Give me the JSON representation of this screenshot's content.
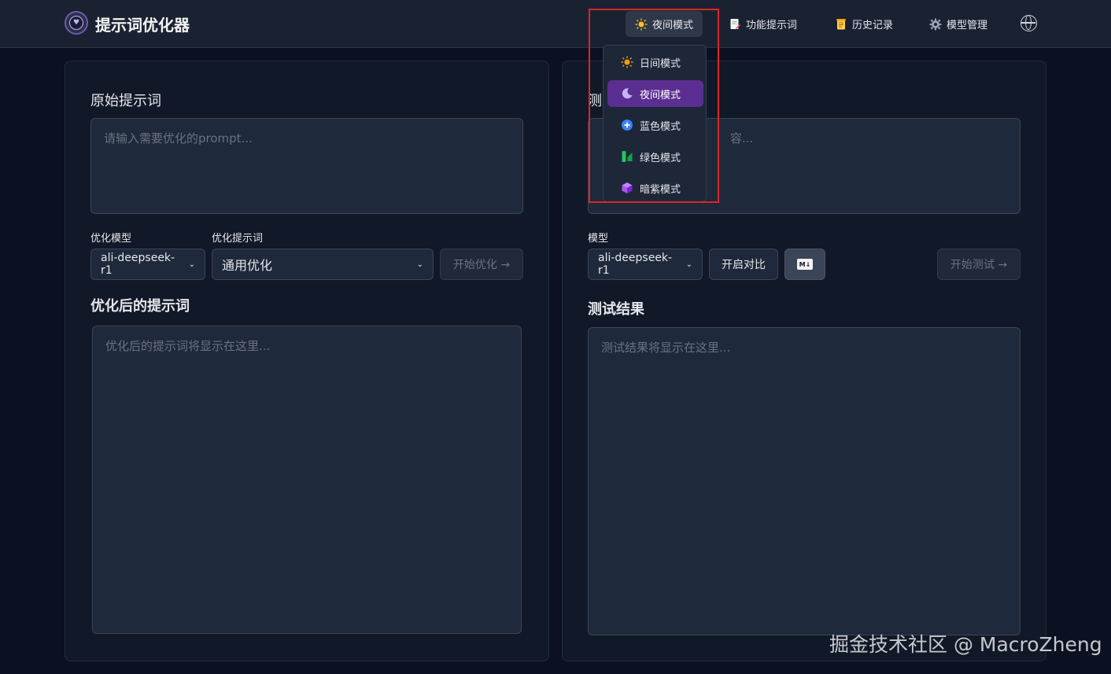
{
  "header": {
    "app_title": "提示词优化器",
    "nav": {
      "theme_label": "夜间模式",
      "features_label": "功能提示词",
      "history_label": "历史记录",
      "models_label": "模型管理"
    },
    "icons": {
      "logo": "heart-shield-icon",
      "theme": "sun-icon",
      "features": "document-icon",
      "history": "scroll-icon",
      "models": "gear-icon",
      "language": "globe-icon"
    }
  },
  "theme_menu": {
    "items": [
      {
        "label": "日间模式",
        "icon": "sun-icon",
        "color": "#f59e0b"
      },
      {
        "label": "夜间模式",
        "icon": "moon-icon",
        "color": "#c4b5fd",
        "selected": true
      },
      {
        "label": "蓝色模式",
        "icon": "blue-circle-plus-icon",
        "color": "#3b82f6"
      },
      {
        "label": "绿色模式",
        "icon": "green-chart-icon",
        "color": "#22c55e"
      },
      {
        "label": "暗紫模式",
        "icon": "purple-cube-icon",
        "color": "#a855f7"
      }
    ]
  },
  "left": {
    "original_title": "原始提示词",
    "original_placeholder": "请输入需要优化的prompt...",
    "model_label": "优化模型",
    "prompt_label": "优化提示词",
    "model_value": "ali-deepseek-r1",
    "prompt_value": "通用优化",
    "start_button": "开始优化 →",
    "optimized_title": "优化后的提示词",
    "optimized_placeholder": "优化后的提示词将显示在这里..."
  },
  "right": {
    "test_title_partial": "测",
    "test_placeholder_partial": "容...",
    "model_label": "模型",
    "model_value": "ali-deepseek-r1",
    "compare_button": "开启对比",
    "md_badge": "M↓",
    "start_test_button": "开始测试 →",
    "result_title": "测试结果",
    "result_placeholder": "测试结果将显示在这里..."
  },
  "watermark": "掘金技术社区 @ MacroZheng",
  "colors": {
    "accent": "#5b2e91",
    "highlight": "#dc2626"
  }
}
